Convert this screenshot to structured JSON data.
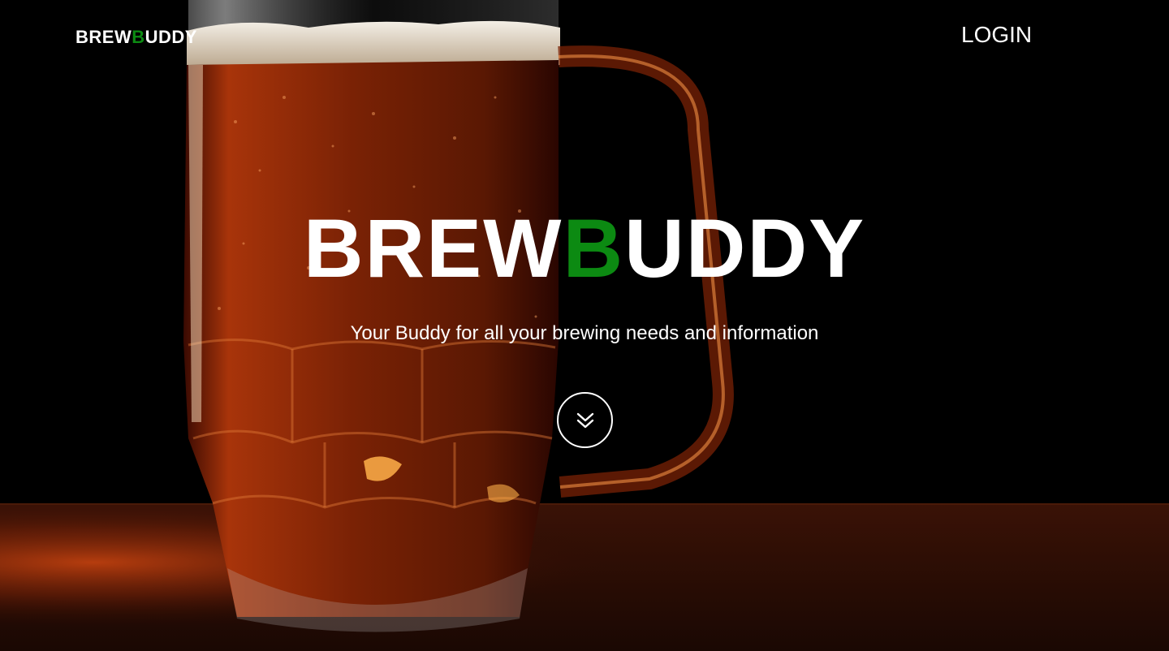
{
  "header": {
    "logo": {
      "part1": "BREW",
      "accent": "B",
      "part2": "UDDY"
    },
    "login_label": "LOGIN"
  },
  "hero": {
    "title": {
      "part1": "BREW",
      "accent": "B",
      "part2": "UDDY"
    },
    "subtitle": "Your Buddy for all your brewing needs and information",
    "scroll_icon": "double-chevron-down-icon"
  },
  "colors": {
    "accent": "#0c8a12",
    "text": "#ffffff",
    "background": "#000000",
    "beer": "#8a2a06",
    "table": "#5a1c08"
  }
}
